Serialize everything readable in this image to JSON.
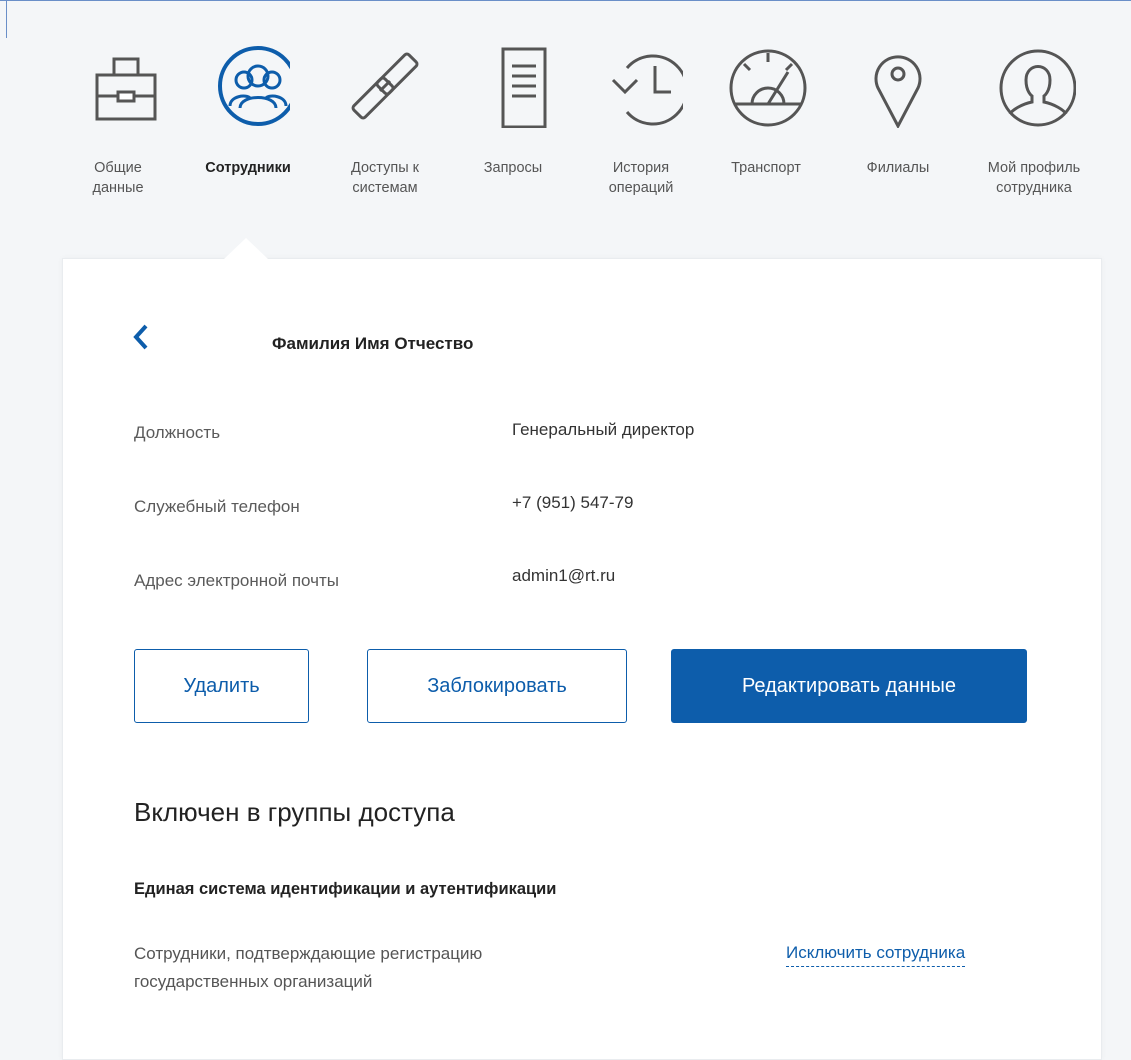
{
  "nav": [
    {
      "label": "Общие\nданные",
      "icon": "briefcase-icon",
      "active": false
    },
    {
      "label": "Сотрудники",
      "icon": "employees-icon",
      "active": true
    },
    {
      "label": "Доступы к\nсистемам",
      "icon": "link-chain-icon",
      "active": false
    },
    {
      "label": "Запросы",
      "icon": "document-icon",
      "active": false
    },
    {
      "label": "История\nопераций",
      "icon": "history-icon",
      "active": false
    },
    {
      "label": "Транспорт",
      "icon": "speedometer-icon",
      "active": false
    },
    {
      "label": "Филиалы",
      "icon": "map-pin-icon",
      "active": false
    },
    {
      "label": "Мой профиль\nсотрудника",
      "icon": "user-profile-icon",
      "active": false
    }
  ],
  "employee": {
    "name": "Фамилия Имя Отчество",
    "fields": [
      {
        "label": "Должность",
        "value": "Генеральный директор"
      },
      {
        "label": "Служебный телефон",
        "value": "+7 (951) 547-79"
      },
      {
        "label": "Адрес электронной почты",
        "value": "admin1@rt.ru"
      }
    ]
  },
  "actions": {
    "delete": "Удалить",
    "block": "Заблокировать",
    "edit": "Редактировать данные"
  },
  "groups": {
    "title": "Включен в группы доступа",
    "system": "Единая система идентификации и аутентификации",
    "items": [
      {
        "description": "Сотрудники, подтверждающие регистрацию\nгосударственных организаций",
        "action": "Исключить сотрудника"
      }
    ]
  },
  "colors": {
    "accent": "#0d5dab",
    "icon_inactive": "#555555"
  }
}
